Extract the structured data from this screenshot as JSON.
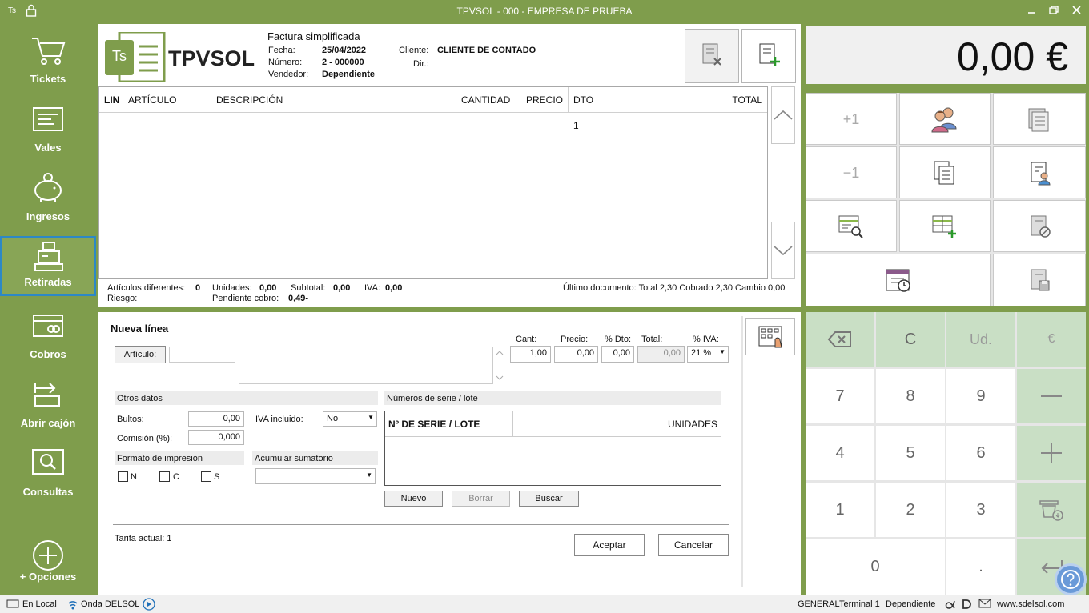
{
  "titlebar": {
    "app_badge": "Ts",
    "title": "TPVSOL - 000 - EMPRESA DE PRUEBA"
  },
  "sidebar": {
    "items": [
      {
        "label": "Tickets",
        "icon": "cart-icon"
      },
      {
        "label": "Vales",
        "icon": "voucher-icon"
      },
      {
        "label": "Ingresos",
        "icon": "piggy-bank-icon"
      },
      {
        "label": "Retiradas",
        "icon": "cash-register-icon"
      },
      {
        "label": "Cobros",
        "icon": "card-icon"
      },
      {
        "label": "Abrir cajón",
        "icon": "open-drawer-icon"
      },
      {
        "label": "Consultas",
        "icon": "search-icon"
      },
      {
        "label": "+ Opciones",
        "icon": "plus-circle-icon"
      }
    ]
  },
  "header": {
    "logo_badge": "Ts",
    "logo_text": "TPVSOL",
    "doc_type": "Factura simplificada",
    "fecha_label": "Fecha:",
    "fecha": "25/04/2022",
    "numero_label": "Número:",
    "numero": "2 - 000000",
    "vendedor_label": "Vendedor:",
    "vendedor": "Dependiente",
    "cliente_label": "Cliente:",
    "cliente": "CLIENTE DE CONTADO",
    "dir_label": "Dir.:"
  },
  "table": {
    "columns": [
      "LIN",
      "ARTÍCULO",
      "DESCRIPCIÓN",
      "CANTIDAD",
      "PRECIO",
      "DTO 1",
      "TOTAL"
    ]
  },
  "summary": {
    "articulos_label": "Artículos diferentes:",
    "articulos": "0",
    "unidades_label": "Unidades:",
    "unidades": "0,00",
    "subtotal_label": "Subtotal:",
    "subtotal": "0,00",
    "iva_label": "IVA:",
    "iva": "0,00",
    "riesgo_label": "Riesgo:",
    "pendiente_label": "Pendiente cobro:",
    "pendiente": "0,49-",
    "ultimo_doc": "Último documento: Total 2,30 Cobrado 2,30 Cambio 0,00"
  },
  "nueva_linea": {
    "title": "Nueva línea",
    "articulo_button": "Artículo:",
    "cant_label": "Cant:",
    "cant": "1,00",
    "precio_label": "Precio:",
    "precio": "0,00",
    "dto_label": "% Dto:",
    "dto": "0,00",
    "total_label": "Total:",
    "total": "0,00",
    "iva_label": "% IVA:",
    "iva": "21 %",
    "otros_datos": "Otros datos",
    "bultos_label": "Bultos:",
    "bultos": "0,00",
    "comision_label": "Comisión (%):",
    "comision": "0,000",
    "iva_incluido_label": "IVA incluido:",
    "iva_incluido": "No",
    "formato_label": "Formato de impresión",
    "formato_options": [
      "N",
      "C",
      "S"
    ],
    "acumular_label": "Acumular sumatorio",
    "series_section": "Números de serie / lote",
    "series_col1": "Nº DE SERIE / LOTE",
    "series_col2": "UNIDADES",
    "nuevo": "Nuevo",
    "borrar": "Borrar",
    "buscar": "Buscar",
    "tarifa": "Tarifa actual: 1",
    "aceptar": "Aceptar",
    "cancelar": "Cancelar"
  },
  "display": {
    "amount": "0,00 €"
  },
  "actions": {
    "plus_one": "+1",
    "minus_one": "−1"
  },
  "keypad": {
    "clear": "C",
    "units": "Ud.",
    "euro": "€",
    "k7": "7",
    "k8": "8",
    "k9": "9",
    "k4": "4",
    "k5": "5",
    "k6": "6",
    "k1": "1",
    "k2": "2",
    "k3": "3",
    "k0": "0",
    "dot": "."
  },
  "statusbar": {
    "local": "En Local",
    "onda": "Onda DELSOL",
    "general": "GENERAL",
    "terminal": "Terminal 1",
    "user": "Dependiente",
    "website": "www.sdelsol.com"
  },
  "colors": {
    "accent_green": "#7f9d4c",
    "key_green": "#c9dfc5",
    "selection_blue": "#2c88c6"
  }
}
